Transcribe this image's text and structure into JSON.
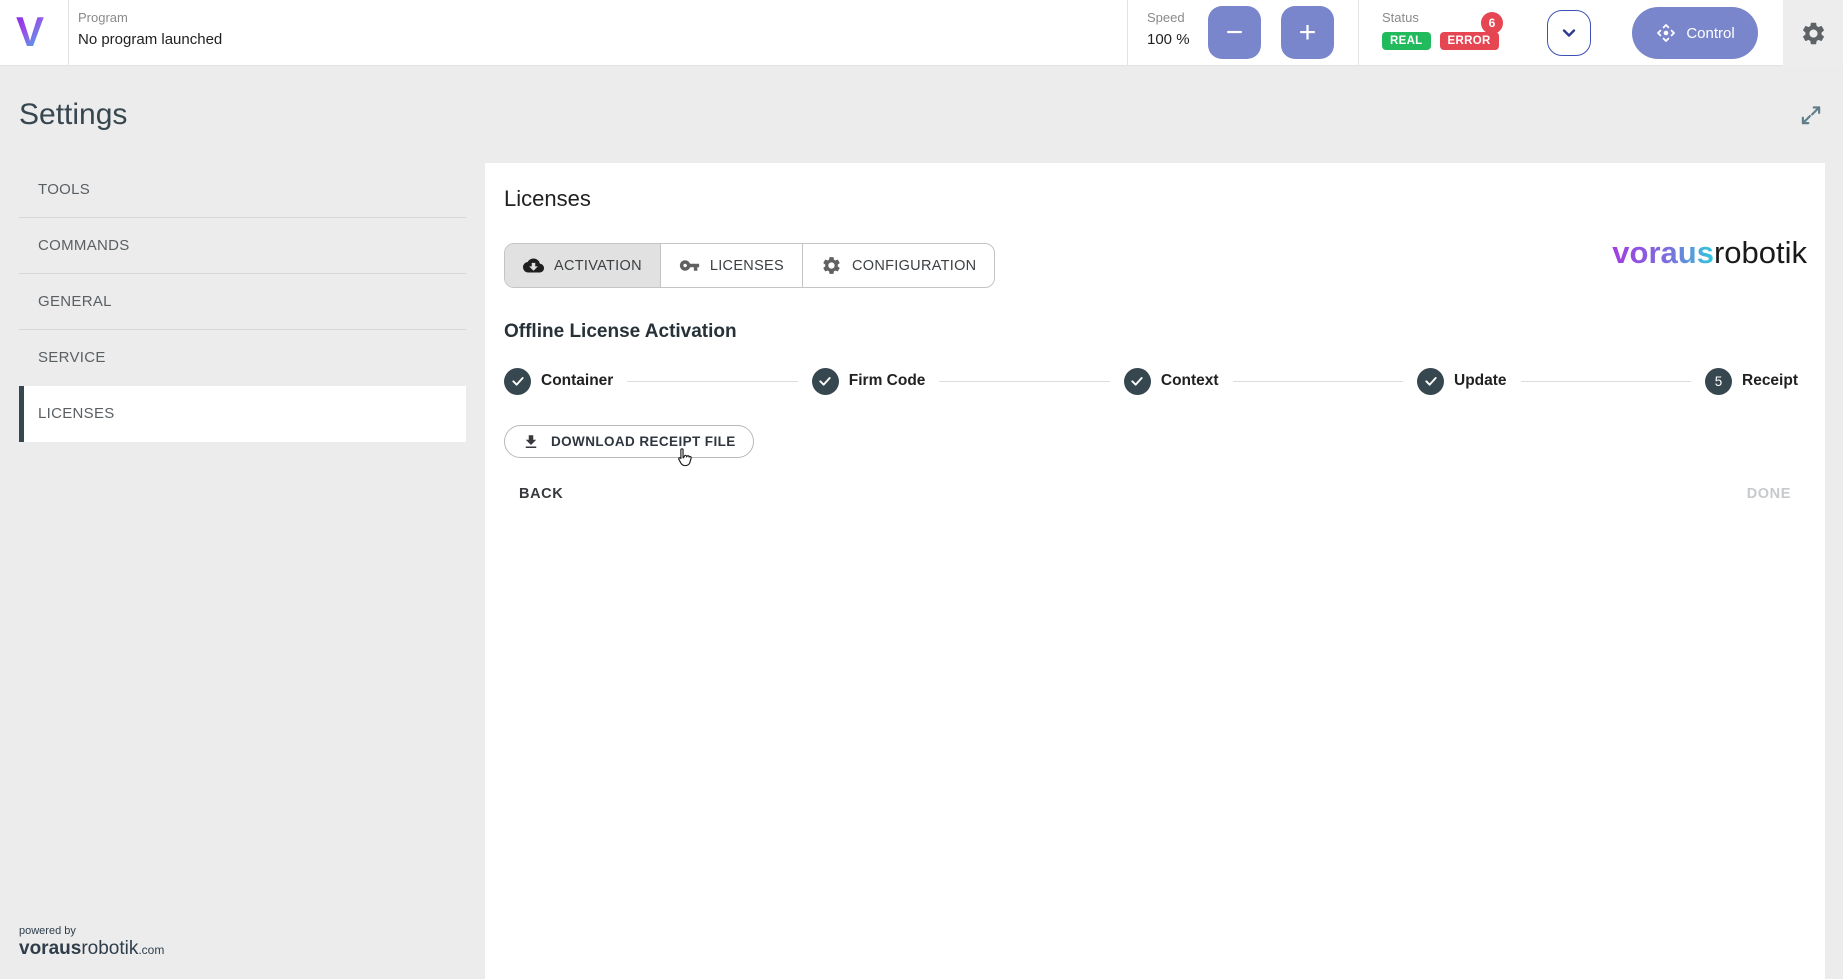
{
  "app": {
    "logo_letter": "V"
  },
  "topbar": {
    "program": {
      "label": "Program",
      "value": "No program launched"
    },
    "speed": {
      "label": "Speed",
      "value": "100 %",
      "minus_label": "−",
      "plus_label": "+"
    },
    "status": {
      "label": "Status",
      "error_count": "6",
      "badges": [
        {
          "label": "REAL"
        },
        {
          "label": "ERROR"
        }
      ]
    },
    "control": {
      "label": "Control"
    }
  },
  "page": {
    "title": "Settings"
  },
  "sidebar": {
    "items": [
      {
        "label": "TOOLS",
        "selected": false
      },
      {
        "label": "COMMANDS",
        "selected": false
      },
      {
        "label": "GENERAL",
        "selected": false
      },
      {
        "label": "SERVICE",
        "selected": false
      },
      {
        "label": "LICENSES",
        "selected": true
      }
    ]
  },
  "panel": {
    "title": "Licenses",
    "tabs": [
      {
        "label": "ACTIVATION",
        "icon": "cloud-download-icon",
        "active": true
      },
      {
        "label": "LICENSES",
        "icon": "key-icon",
        "active": false
      },
      {
        "label": "CONFIGURATION",
        "icon": "gear-icon",
        "active": false
      }
    ],
    "section_title": "Offline License Activation",
    "steps": [
      {
        "label": "Container",
        "state": "completed"
      },
      {
        "label": "Firm Code",
        "state": "completed"
      },
      {
        "label": "Context",
        "state": "completed"
      },
      {
        "label": "Update",
        "state": "completed"
      },
      {
        "label": "Receipt",
        "state": "active",
        "number": "5"
      }
    ],
    "download_button_label": "DOWNLOAD RECEIPT FILE",
    "back_label": "BACK",
    "done_label": "DONE",
    "brand": {
      "bold": "voraus",
      "regular": "robotik"
    }
  },
  "footer": {
    "powered_by": "powered by",
    "brand_bold": "voraus",
    "brand_regular": "robotik",
    "domain": ".com"
  },
  "colors": {
    "accent_indigo": "#7986cb",
    "badge_green": "#21ba5c",
    "badge_red": "#e64552",
    "dark_slate": "#37474f",
    "brand_gradient_start": "#a13ee1",
    "brand_gradient_end": "#2fc8dd",
    "page_bg": "#ececec"
  }
}
